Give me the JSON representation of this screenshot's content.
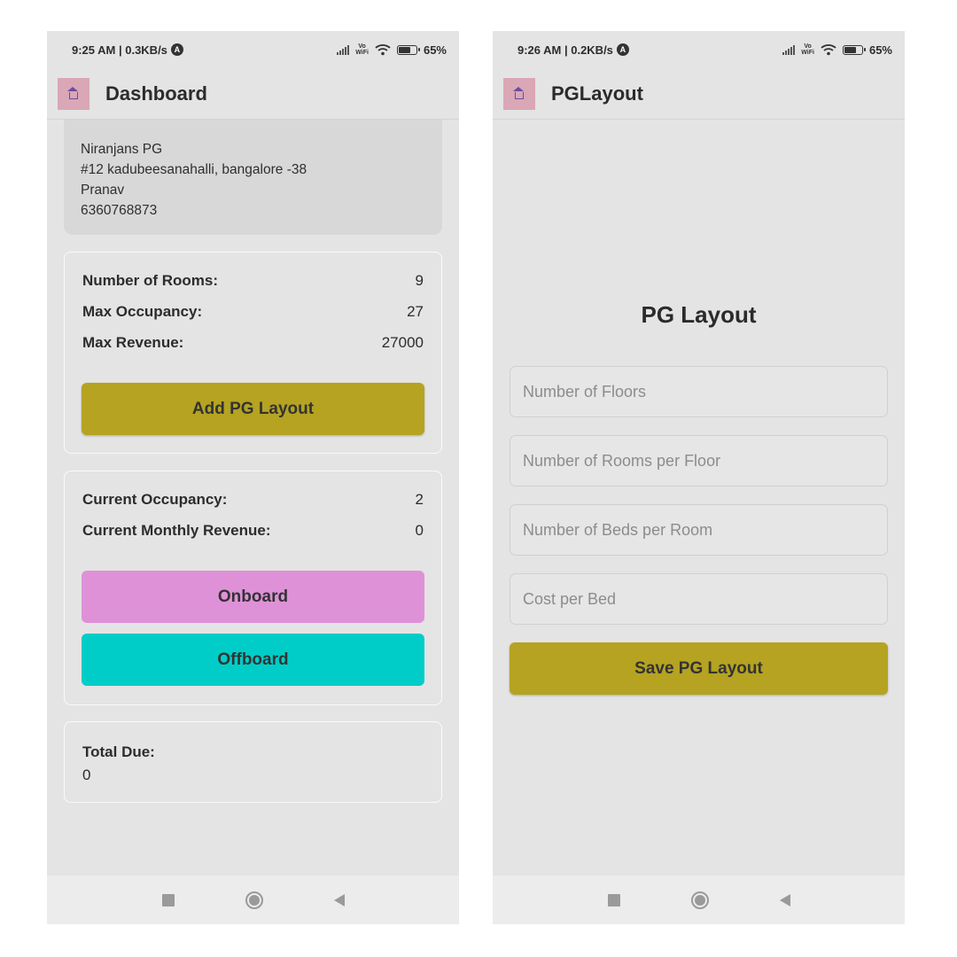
{
  "left_screen": {
    "status": {
      "time": "9:25 AM | 0.3KB/s",
      "badge": "A",
      "vowifi_top": "Vo",
      "vowifi_bottom": "WiFi",
      "battery": "65%"
    },
    "header": {
      "title": "Dashboard"
    },
    "pg_info": {
      "name": "Niranjans PG",
      "address": "#12 kadubeesanahalli, bangalore -38",
      "owner": "Pranav",
      "phone": "6360768873"
    },
    "stats": {
      "rooms_label": "Number of Rooms:",
      "rooms_value": "9",
      "max_occupancy_label": "Max Occupancy:",
      "max_occupancy_value": "27",
      "max_revenue_label": "Max Revenue:",
      "max_revenue_value": "27000",
      "add_layout_button": "Add PG Layout"
    },
    "occupancy": {
      "current_occupancy_label": "Current Occupancy:",
      "current_occupancy_value": "2",
      "monthly_revenue_label": "Current Monthly Revenue:",
      "monthly_revenue_value": "0",
      "onboard_button": "Onboard",
      "offboard_button": "Offboard"
    },
    "due": {
      "label": "Total Due:",
      "value": "0"
    }
  },
  "right_screen": {
    "status": {
      "time": "9:26 AM | 0.2KB/s",
      "badge": "A",
      "vowifi_top": "Vo",
      "vowifi_bottom": "WiFi",
      "battery": "65%"
    },
    "header": {
      "title": "PGLayout"
    },
    "form": {
      "title": "PG Layout",
      "floors_placeholder": "Number of Floors",
      "rooms_placeholder": "Number of Rooms per Floor",
      "beds_placeholder": "Number of Beds per Room",
      "cost_placeholder": "Cost per Bed",
      "save_button": "Save PG Layout"
    }
  },
  "colors": {
    "olive_button": "#b5a321",
    "pink_button": "#df91d8",
    "cyan_button": "#01cdc8",
    "screen_background": "#e4e4e4"
  }
}
